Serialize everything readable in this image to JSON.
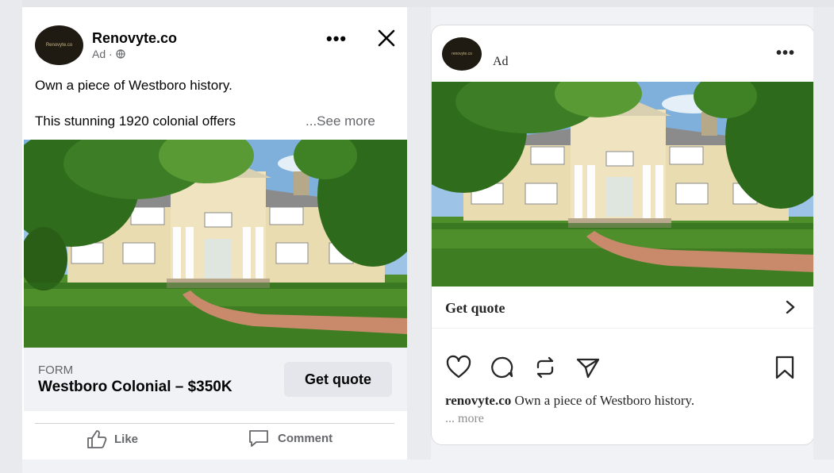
{
  "facebook": {
    "avatar_text": "Renovyte.co",
    "brand": "Renovyte.co",
    "sponsored": "Ad · ",
    "text_line1": "Own a piece of Westboro history.",
    "text_line2": "This stunning 1920 colonial offers",
    "see_more": "...See more",
    "form_label": "FORM",
    "offer_title": "Westboro Colonial – $350K",
    "cta_label": "Get quote",
    "like_label": "Like",
    "comment_label": "Comment"
  },
  "instagram": {
    "avatar_text": "renovyte.co",
    "ad_label": "Ad",
    "cta_label": "Get quote",
    "caption_user": "renovyte.co",
    "caption_text": " Own a piece of Westboro history.",
    "more_label": "... more"
  },
  "colors": {
    "fb_bg": "#f0f2f5",
    "fb_button": "#e4e6eb",
    "text_dark": "#050505",
    "text_muted": "#65676b"
  },
  "icons": [
    "more-dots-icon",
    "close-icon",
    "globe-icon",
    "like-icon",
    "comment-icon",
    "heart-icon",
    "chat-bubble-icon",
    "repost-icon",
    "send-icon",
    "bookmark-icon",
    "chevron-right-icon"
  ]
}
